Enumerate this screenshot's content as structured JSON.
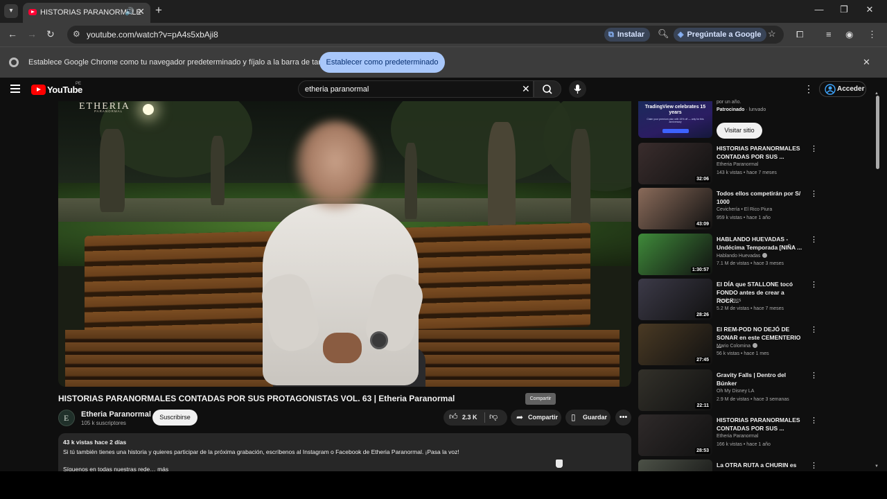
{
  "browser": {
    "tab_title": "HISTORIAS PARANORMALE",
    "url": "youtube.com/watch?v=pA4s5xbAji8",
    "install_label": "Instalar",
    "ask_google_label": "Pregúntale a Google",
    "infobar_message": "Establece Google Chrome como tu navegador predeterminado y fíjalo a la barra de tareas",
    "infobar_button": "Establecer como predeterminado"
  },
  "youtube": {
    "logo_text": "YouTube",
    "country_code": "PE",
    "search_query": "etheria paranormal",
    "signin_label": "Acceder"
  },
  "video": {
    "watermark": "ETHERIA",
    "watermark_sub": "PARANORMAL",
    "title": "HISTORIAS PARANORMALES CONTADAS POR SUS PROTAGONISTAS VOL. 63 | Etheria Paranormal",
    "channel": "Etheria Paranormal",
    "subscribers": "105 k suscriptores",
    "subscribe_label": "Suscribirse",
    "likes": "2.3 K",
    "share_label": "Compartir",
    "save_label": "Guardar",
    "tooltip": "Compartir",
    "views_date": "43 k vistas  hace 2 días",
    "description_line1": "Si tú también tienes una historia y quieres participar de la próxima grabación, escríbenos al Instagram o Facebook de Etheria Paranormal. ¡Pasa la voz!",
    "description_line2": "Síguenos en todas nuestras rede…  más"
  },
  "sidebar": {
    "ad": {
      "thumb_title": "TradingView celebrates 15 years",
      "thumb_sub": "Claim your premium plan with 15% off — only for this anniversary",
      "top_text": "por un año.",
      "sponsored": "Patrocinado",
      "advertiser": "lunvado",
      "visit_label": "Visitar sitio"
    },
    "items": [
      {
        "title": "HISTORIAS PARANORMALES CONTADAS POR SUS ...",
        "channel": "Etheria Paranormal",
        "verified": false,
        "meta": "143 k vistas • hace 7 meses",
        "duration": "32:06",
        "thumb": "#3a2d2d"
      },
      {
        "title": "Todos ellos competirán por S/ 1000",
        "channel": "Cevichería • El Rico Piura",
        "verified": false,
        "meta": "959 k vistas • hace 1 año",
        "duration": "43:09",
        "thumb": "#8a6b5a"
      },
      {
        "title": "HABLANDO HUEVADAS - Undécima Temporada [NIÑA ...",
        "channel": "Hablando Huevadas",
        "verified": true,
        "meta": "7.1 M de vistas • hace 3 meses",
        "duration": "1:30:57",
        "thumb": "#3f8a3a"
      },
      {
        "title": "El DÍA que STALLONE tocó FONDO antes de crear a ROCK...",
        "channel": "Dieck Docs",
        "verified": false,
        "meta": "5.2 M de vistas • hace 7 meses",
        "duration": "28:26",
        "thumb": "#3c3a48"
      },
      {
        "title": "El REM-POD NO DEJÓ DE SONAR en este CEMENTERIO ...",
        "channel": "Mario Colomina",
        "verified": true,
        "meta": "56 k vistas • hace 1 mes",
        "duration": "27:45",
        "thumb": "#4a3a24"
      },
      {
        "title": "Gravity Falls | Dentro del Búnker",
        "channel": "Oh My Disney LA",
        "verified": false,
        "meta": "2.9 M de vistas • hace 3 semanas",
        "duration": "22:11",
        "thumb": "#33312a"
      },
      {
        "title": "HISTORIAS PARANORMALES CONTADAS POR SUS ...",
        "channel": "Etheria Paranormal",
        "verified": false,
        "meta": "166 k vistas • hace 1 año",
        "duration": "28:53",
        "thumb": "#2f2a2a"
      },
      {
        "title": "La OTRA RUTA a CHURIN es",
        "channel": "",
        "verified": false,
        "meta": "",
        "duration": "",
        "thumb": "#4c5147"
      }
    ]
  },
  "colors": {
    "accent": "#3ea6ff",
    "youtube_red": "#ff0000",
    "page_bg": "#0f0f0f",
    "chip_bg": "#272727"
  }
}
